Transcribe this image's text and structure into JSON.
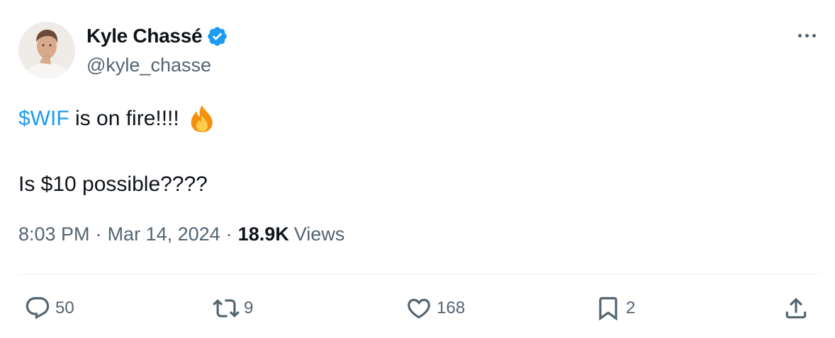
{
  "author": {
    "display_name": "Kyle Chassé",
    "handle": "@kyle_chasse",
    "verified": true
  },
  "tweet": {
    "cashtag": "$WIF",
    "line1_rest": " is on fire!!!!",
    "line1_emoji": "fire-emoji",
    "line2": "Is $10 possible????"
  },
  "meta": {
    "time": "8:03 PM",
    "separator": "·",
    "date": "Mar 14, 2024",
    "views_count": "18.9K",
    "views_label": "Views"
  },
  "actions": {
    "replies": "50",
    "reposts": "9",
    "likes": "168",
    "bookmarks": "2"
  },
  "colors": {
    "link": "#1d9bf0",
    "secondary_text": "#536471",
    "primary_text": "#0f1419",
    "verified_badge": "#1d9bf0",
    "divider": "#eff3f4"
  }
}
